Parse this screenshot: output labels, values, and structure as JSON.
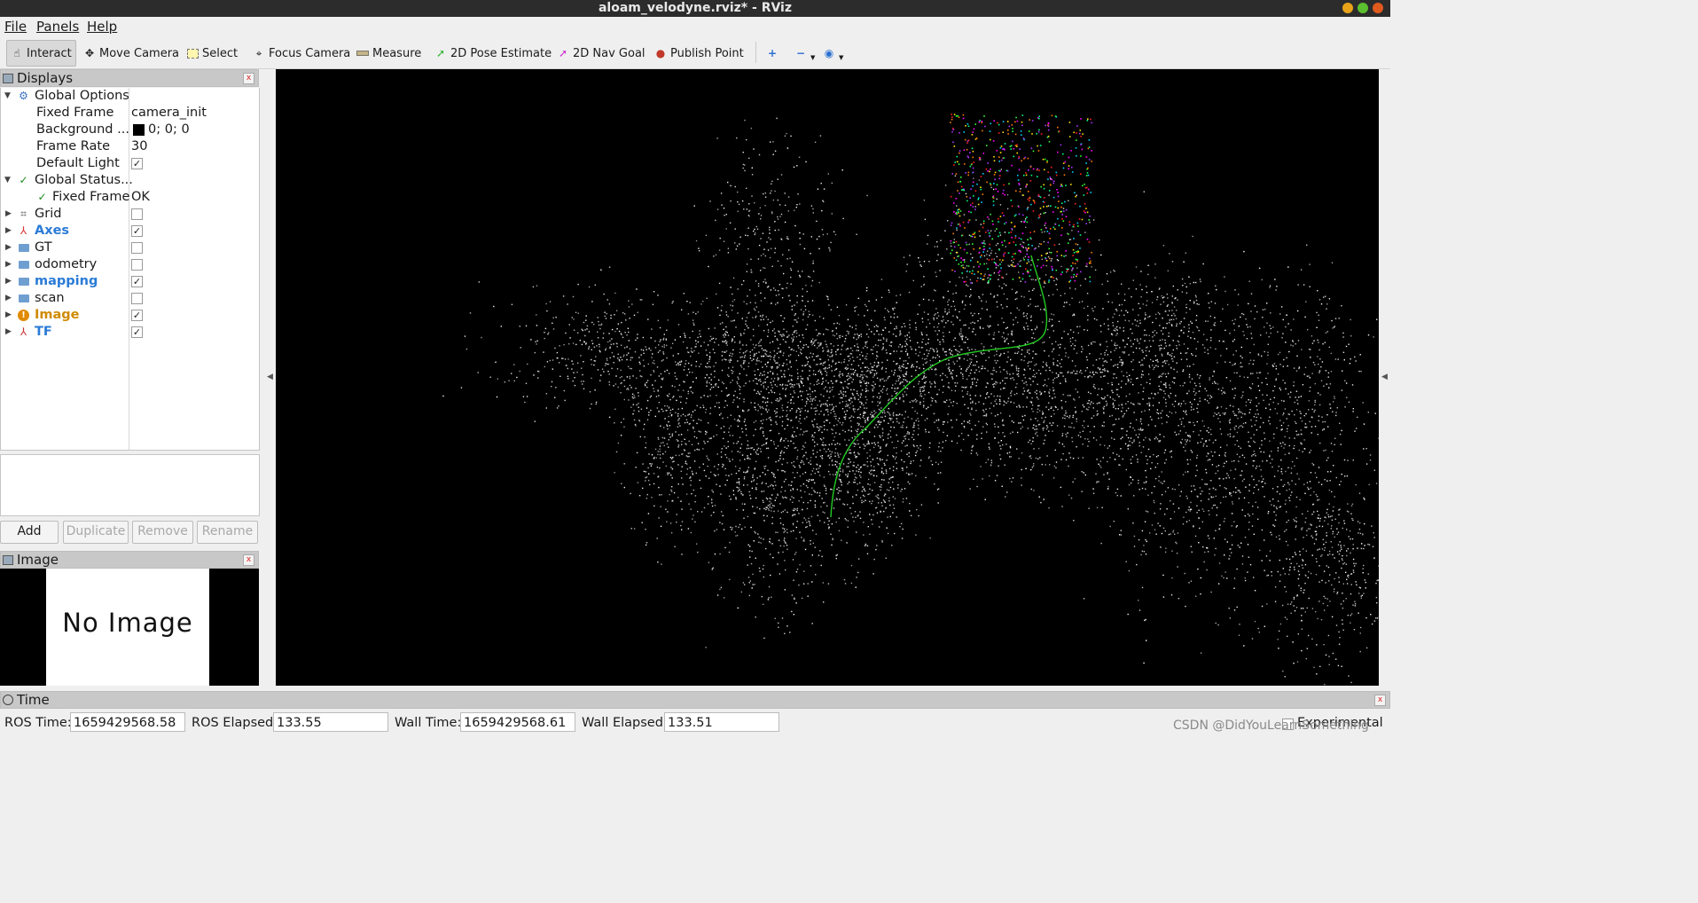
{
  "window": {
    "title": "aloam_velodyne.rviz* - RViz"
  },
  "menu": {
    "file": "File",
    "panels": "Panels",
    "help": "Help"
  },
  "toolbar": {
    "interact": "Interact",
    "move_camera": "Move Camera",
    "select": "Select",
    "focus_camera": "Focus Camera",
    "measure": "Measure",
    "pose_estimate": "2D Pose Estimate",
    "nav_goal": "2D Nav Goal",
    "publish_point": "Publish Point"
  },
  "displays": {
    "title": "Displays",
    "global_options": "Global Options",
    "fixed_frame_label": "Fixed Frame",
    "fixed_frame_value": "camera_init",
    "background_label": "Background ...",
    "background_value": "0; 0; 0",
    "frame_rate_label": "Frame Rate",
    "frame_rate_value": "30",
    "default_light_label": "Default Light",
    "global_status": "Global Status...",
    "status_fixed_frame_label": "Fixed Frame",
    "status_fixed_frame_value": "OK",
    "items": [
      {
        "label": "Grid",
        "checked": false
      },
      {
        "label": "Axes",
        "checked": true
      },
      {
        "label": "GT",
        "checked": false
      },
      {
        "label": "odometry",
        "checked": false
      },
      {
        "label": "mapping",
        "checked": true
      },
      {
        "label": "scan",
        "checked": false
      },
      {
        "label": "Image",
        "checked": true
      },
      {
        "label": "TF",
        "checked": true
      }
    ],
    "buttons": {
      "add": "Add",
      "duplicate": "Duplicate",
      "remove": "Remove",
      "rename": "Rename"
    }
  },
  "image_panel": {
    "title": "Image",
    "placeholder": "No Image"
  },
  "time": {
    "title": "Time",
    "ros_time_label": "ROS Time:",
    "ros_time_value": "1659429568.58",
    "ros_elapsed_label": "ROS Elapsed:",
    "ros_elapsed_value": "133.55",
    "wall_time_label": "Wall Time:",
    "wall_time_value": "1659429568.61",
    "wall_elapsed_label": "Wall Elapsed:",
    "wall_elapsed_value": "133.51",
    "experimental_label": "Experimental"
  },
  "watermark": "CSDN @DidYouLearnSomething",
  "colors": {
    "viewport_bg": "#000000",
    "trajectory": "#22cc22",
    "accent_blue": "#2a7bd6",
    "warn_orange": "#d08a00"
  }
}
